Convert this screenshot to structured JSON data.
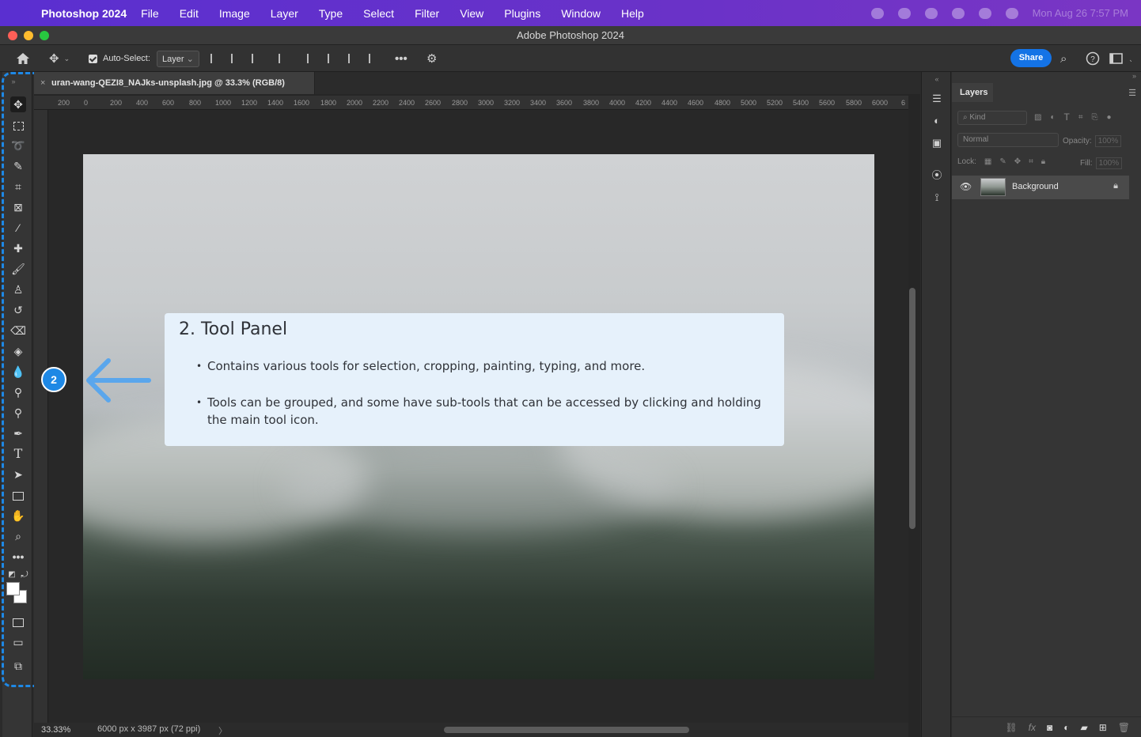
{
  "menubar": {
    "app_name": "Photoshop 2024",
    "items": [
      "File",
      "Edit",
      "Image",
      "Layer",
      "Type",
      "Select",
      "Filter",
      "View",
      "Plugins",
      "Window",
      "Help"
    ],
    "datetime": "Mon Aug 26 7:57 PM"
  },
  "window": {
    "title": "Adobe Photoshop 2024"
  },
  "options_bar": {
    "auto_select_label": "Auto-Select:",
    "auto_select_value": "Layer",
    "share_label": "Share"
  },
  "document": {
    "tab_title": "uran-wang-QEZI8_NAJks-unsplash.jpg @ 33.3% (RGB/8)",
    "zoom": "33.33%",
    "dimensions": "6000 px x 3987 px (72 ppi)",
    "ruler_labels": [
      "200",
      "0",
      "200",
      "400",
      "600",
      "800",
      "1000",
      "1200",
      "1400",
      "1600",
      "1800",
      "2000",
      "2200",
      "2400",
      "2600",
      "2800",
      "3000",
      "3200",
      "3400",
      "3600",
      "3800",
      "4000",
      "4200",
      "4400",
      "4600",
      "4800",
      "5000",
      "5200",
      "5400",
      "5600",
      "5800",
      "6000",
      "6"
    ]
  },
  "callout": {
    "badge": "2",
    "title": "2. Tool Panel",
    "bullets": [
      "Contains various tools for selection, cropping, painting, typing, and more.",
      "Tools can be grouped, and some have sub-tools that can be accessed by clicking and holding the main tool icon."
    ],
    "highlight_color": "#1e88e5"
  },
  "layers_panel": {
    "tab_label": "Layers",
    "filter_placeholder": "Kind",
    "blend_mode": "Normal",
    "opacity_label": "Opacity:",
    "opacity_value": "100%",
    "lock_label": "Lock:",
    "fill_label": "Fill:",
    "fill_value": "100%",
    "layers": [
      {
        "name": "Background",
        "locked": true,
        "visible": true
      }
    ]
  }
}
